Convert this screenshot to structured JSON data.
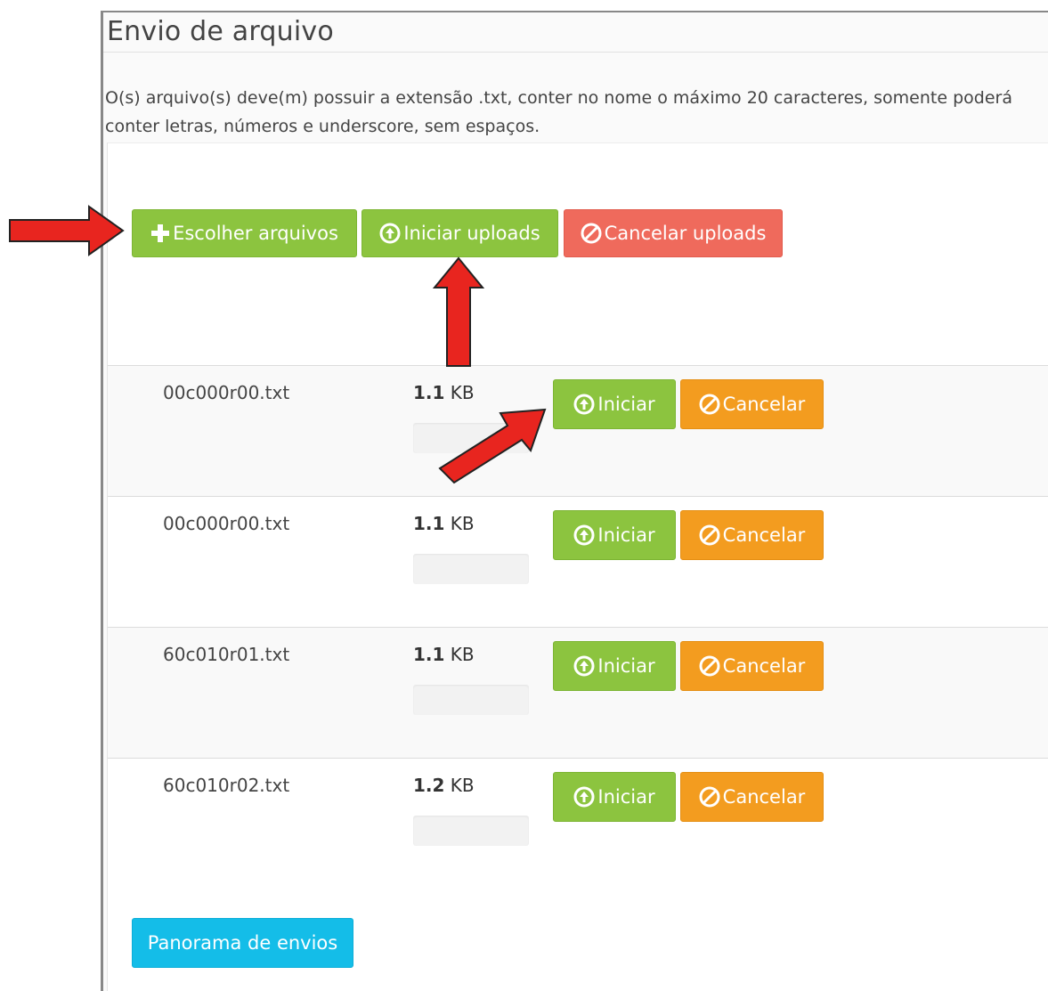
{
  "panel": {
    "title": "Envio de arquivo",
    "description": "O(s) arquivo(s) deve(m) possuir a extensão .txt, conter no nome o máximo 20 caracteres, somente poderá conter letras, números e underscore, sem espaços."
  },
  "toolbar": {
    "choose_label": "Escolher arquivos",
    "start_all_label": "Iniciar uploads",
    "cancel_all_label": "Cancelar uploads"
  },
  "files": [
    {
      "name": "00c000r00.txt",
      "size_value": "1.1",
      "size_unit": "KB",
      "start_label": "Iniciar",
      "cancel_label": "Cancelar",
      "progress": 0
    },
    {
      "name": "00c000r00.txt",
      "size_value": "1.1",
      "size_unit": "KB",
      "start_label": "Iniciar",
      "cancel_label": "Cancelar",
      "progress": 0
    },
    {
      "name": "60c010r01.txt",
      "size_value": "1.1",
      "size_unit": "KB",
      "start_label": "Iniciar",
      "cancel_label": "Cancelar",
      "progress": 0
    },
    {
      "name": "60c010r02.txt",
      "size_value": "1.2",
      "size_unit": "KB",
      "start_label": "Iniciar",
      "cancel_label": "Cancelar",
      "progress": 0
    }
  ],
  "footer": {
    "overview_label": "Panorama de envios"
  },
  "icons": {
    "choose": "plus-icon",
    "start": "circle-arrow-up-icon",
    "cancel": "ban-icon",
    "annotation": "red-arrow-icon"
  },
  "colors": {
    "green": "#8cc43f",
    "red": "#ef6a5c",
    "orange": "#f39c1f",
    "cyan": "#14bde8",
    "annotation_arrow": "#e8251f"
  }
}
